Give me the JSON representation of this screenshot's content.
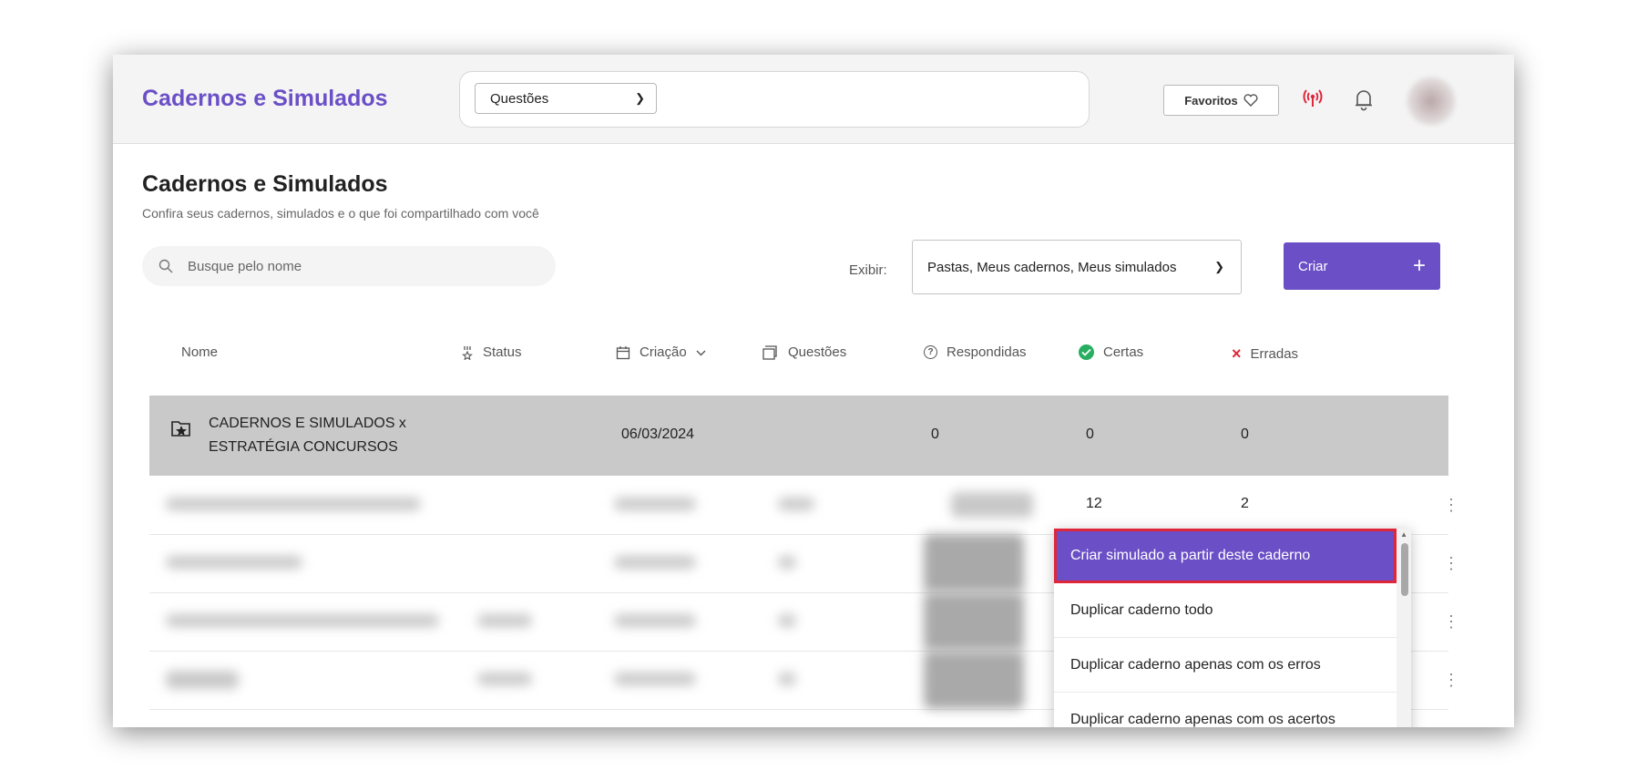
{
  "header": {
    "brand": "Cadernos e Simulados",
    "search_type": "Questões",
    "favorites_label": "Favoritos"
  },
  "page": {
    "title": "Cadernos e Simulados",
    "subtitle": "Confira seus cadernos, simulados e o que foi compartilhado com você",
    "search_placeholder": "Busque pelo nome",
    "view_label": "Exibir:",
    "view_value": "Pastas, Meus cadernos, Meus simulados",
    "create_label": "Criar"
  },
  "table": {
    "columns": {
      "name": "Nome",
      "status": "Status",
      "created": "Criação",
      "questions": "Questões",
      "answered": "Respondidas",
      "correct": "Certas",
      "wrong": "Erradas"
    },
    "folder_row": {
      "name": "CADERNOS E SIMULADOS x ESTRATÉGIA CONCURSOS",
      "created": "06/03/2024",
      "answered": "0",
      "correct": "0",
      "wrong": "0"
    },
    "second_row": {
      "correct": "12",
      "wrong": "2"
    }
  },
  "menu": {
    "items": [
      "Criar simulado a partir deste caderno",
      "Duplicar caderno todo",
      "Duplicar caderno apenas com os erros",
      "Duplicar caderno apenas com os acertos"
    ],
    "active_index": 0
  },
  "colors": {
    "accent": "#6a4fc6",
    "correct": "#27ae60",
    "wrong": "#e0263a",
    "highlight_row": "#c9c9c9"
  }
}
